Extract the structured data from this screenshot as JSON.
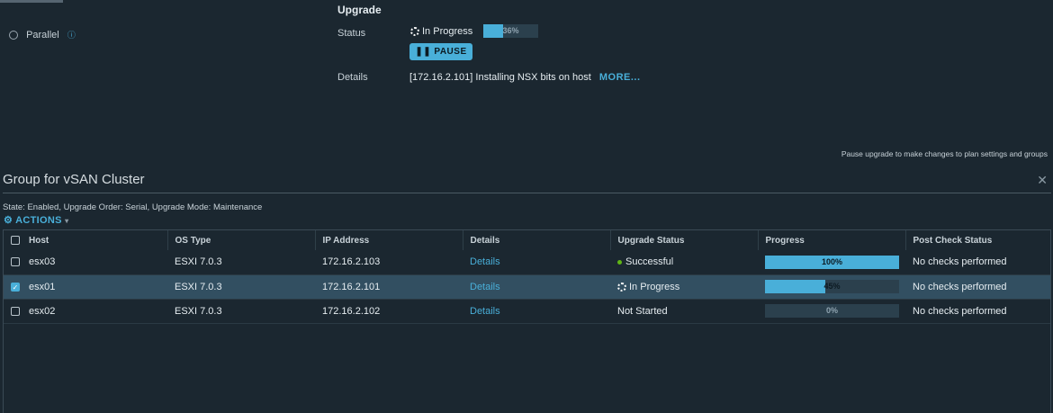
{
  "left": {
    "parallel_label": "Parallel"
  },
  "upgrade": {
    "title": "Upgrade",
    "status_label": "Status",
    "status_text": "In Progress",
    "progress_percent": 36,
    "progress_text": "36%",
    "pause_label": "PAUSE",
    "details_label": "Details",
    "details_text": "[172.16.2.101] Installing NSX bits on host",
    "more_label": "MORE..."
  },
  "hint": "Pause upgrade to make changes to plan settings and groups",
  "group": {
    "title": "Group for vSAN Cluster",
    "state": "State: Enabled, Upgrade Order: Serial, Upgrade Mode: Maintenance",
    "actions_label": "ACTIONS"
  },
  "table": {
    "columns": [
      "Host",
      "OS Type",
      "IP Address",
      "Details",
      "Upgrade Status",
      "Progress",
      "Post Check Status"
    ],
    "rows": [
      {
        "host": "esx03",
        "os": "ESXI 7.0.3",
        "ip": "172.16.2.103",
        "details": "Details",
        "status": "Successful",
        "progress": 100,
        "progress_text": "100%",
        "post": "No checks performed",
        "selected": false
      },
      {
        "host": "esx01",
        "os": "ESXI 7.0.3",
        "ip": "172.16.2.101",
        "details": "Details",
        "status": "In Progress",
        "progress": 45,
        "progress_text": "45%",
        "post": "No checks performed",
        "selected": true
      },
      {
        "host": "esx02",
        "os": "ESXI 7.0.3",
        "ip": "172.16.2.102",
        "details": "Details",
        "status": "Not Started",
        "progress": 0,
        "progress_text": "0%",
        "post": "No checks performed",
        "selected": false
      }
    ]
  },
  "colors": {
    "accent": "#49afd9",
    "success": "#60b515",
    "background": "#1b2730"
  }
}
